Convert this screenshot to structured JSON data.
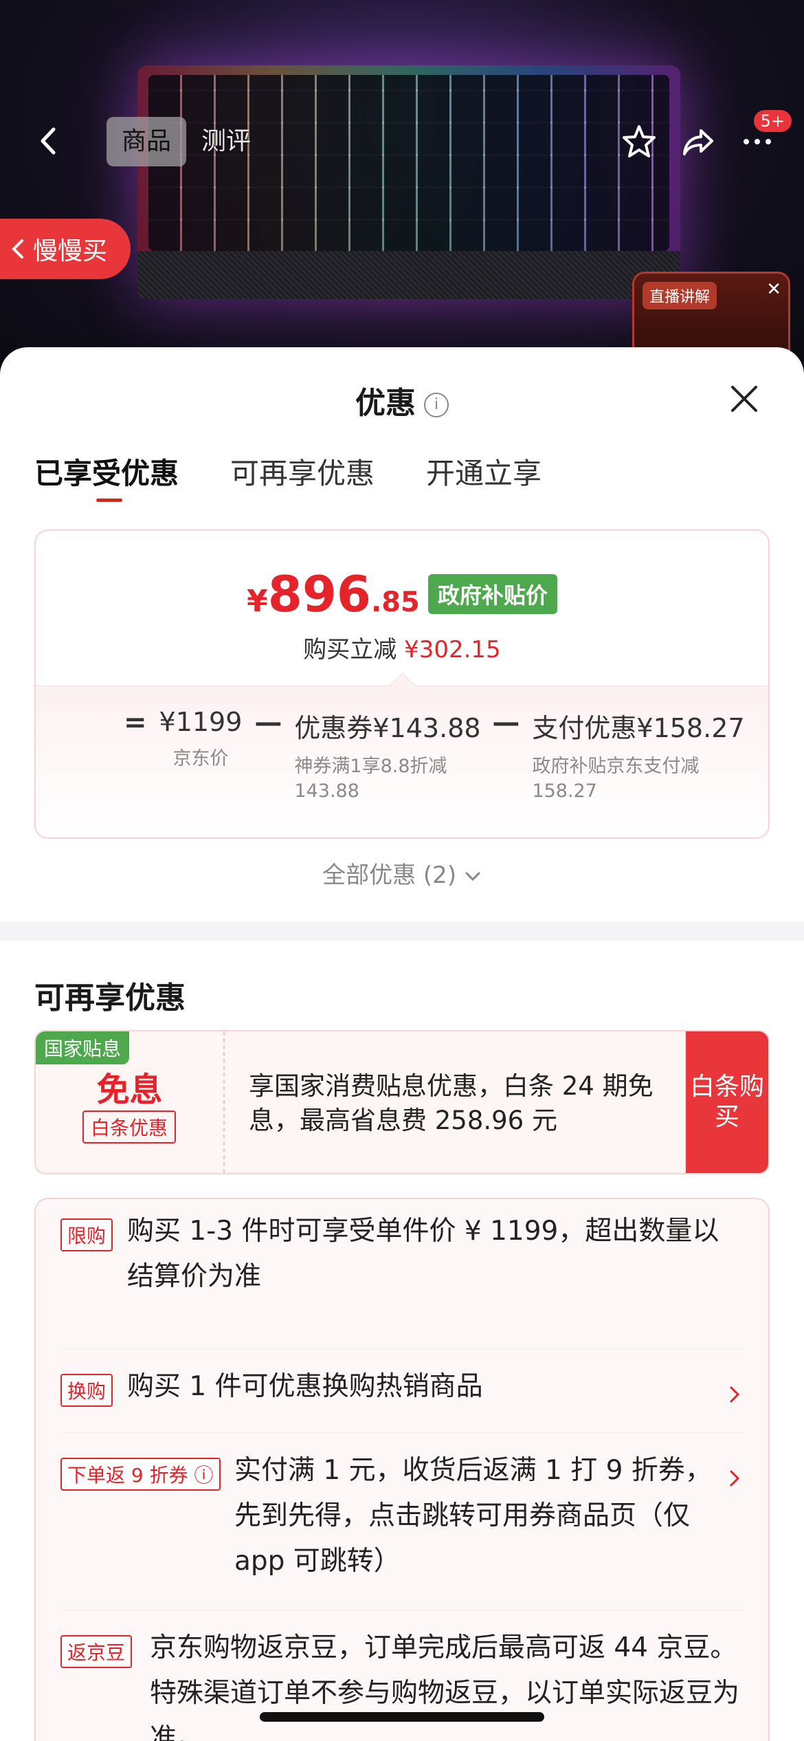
{
  "product_nav": {
    "tab_product": "商品",
    "tab_review": "测评",
    "notification_badge": "5+",
    "slow_buy_label": "慢慢买",
    "live_tag": "直播讲解"
  },
  "sheet": {
    "title": "优惠",
    "tabs": [
      "已享受优惠",
      "可再享优惠",
      "开通立享"
    ],
    "price_card": {
      "currency": "¥",
      "price_int": "896",
      "price_dec": ".85",
      "tag": "政府补贴价",
      "reduce_label": "购买立减",
      "reduce_amount": "¥302.15",
      "calc": {
        "equals": "=",
        "base_value": "¥1199",
        "base_label": "京东价",
        "minus1": "—",
        "coupon_value": "优惠券¥143.88",
        "coupon_desc": "神券满1享8.8折减143.88",
        "minus2": "—",
        "pay_value": "支付优惠¥158.27",
        "pay_desc": "政府补贴京东支付减158.27"
      }
    },
    "all_discounts": "全部优惠 (2)",
    "more_section_title": "可再享优惠",
    "baitiao": {
      "tag": "国家贴息",
      "free": "免息",
      "sub": "白条优惠",
      "text": "享国家消费贴息优惠，白条 24 期免息，最高省息费 258.96 元",
      "button": "白条购买"
    },
    "rules": [
      {
        "tag": "限购",
        "text": "购买 1-3 件时可享受单件价 ¥ 1199，超出数量以结算价为准"
      },
      {
        "tag": "换购",
        "text": "购买 1 件可优惠换购热销商品"
      },
      {
        "tag": "下单返 9 折券 ⓘ",
        "text": "实付满 1 元，收货后返满 1 打 9 折券，先到先得，点击跳转可用券商品页（仅 app 可跳转）"
      },
      {
        "tag": "返京豆",
        "text": "京东购物返京豆，订单完成后最高可返 44 京豆。特殊渠道订单不参与购物返豆，以订单实际返豆为准。"
      }
    ]
  },
  "colors": {
    "accent_red": "#e5232b",
    "gov_green": "#4ea84e"
  }
}
